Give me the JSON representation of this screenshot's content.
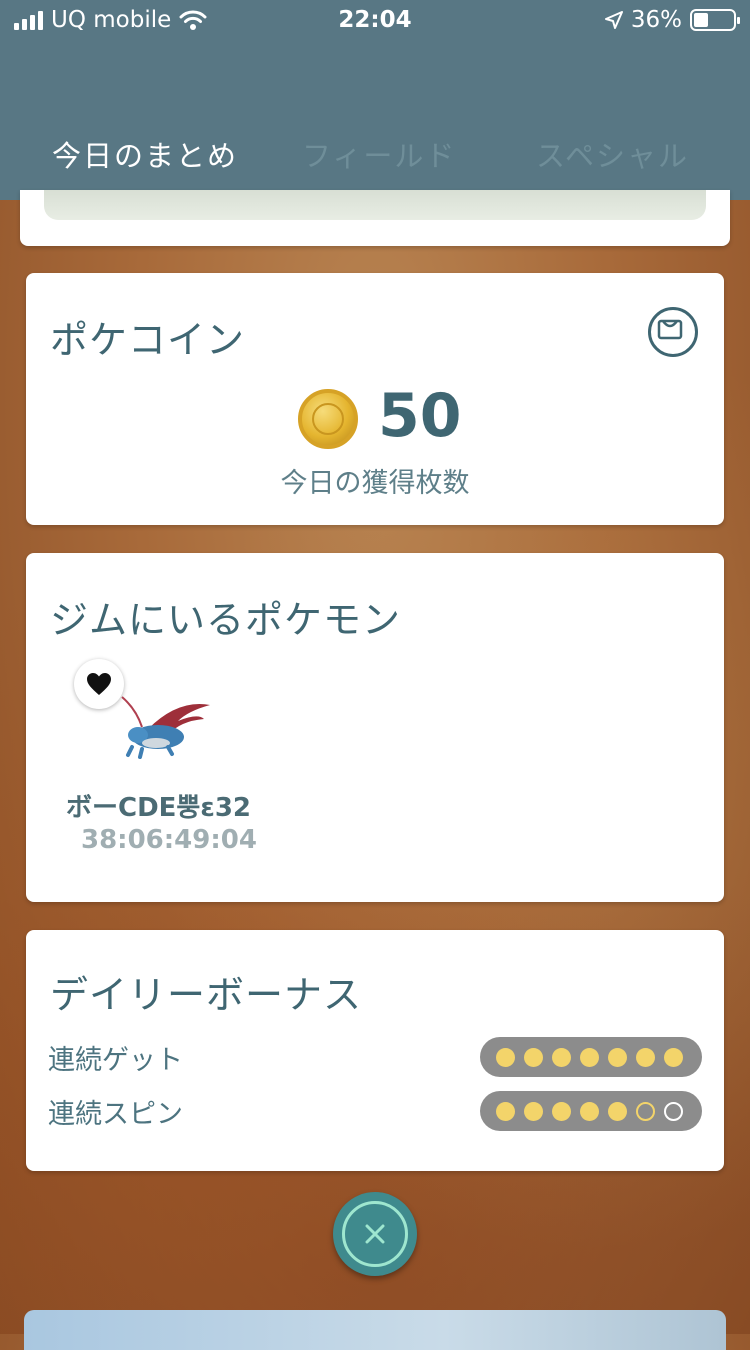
{
  "status_bar": {
    "carrier": "UQ mobile",
    "time": "22:04",
    "battery_percent": "36%",
    "battery_level": 0.36
  },
  "tabs": [
    {
      "label": "今日のまとめ",
      "active": true
    },
    {
      "label": "フィールド",
      "active": false
    },
    {
      "label": "スペシャル",
      "active": false
    }
  ],
  "pokecoin": {
    "title": "ポケコイン",
    "amount": "50",
    "caption": "今日の獲得枚数"
  },
  "gym": {
    "title": "ジムにいるポケモン",
    "gym_name": "ボーCDE뿡ɛ32",
    "timer": "38:06:49:04"
  },
  "daily_bonus": {
    "title": "デイリーボーナス",
    "rows": [
      {
        "label": "連続ゲット",
        "filled": 7,
        "total": 7
      },
      {
        "label": "連続スピン",
        "filled": 5,
        "total": 7
      }
    ]
  },
  "colors": {
    "header": "#587784",
    "title_text": "#3f6672",
    "dot_yellow": "#f3d46a",
    "close_button": "#3f8a8d"
  },
  "icons": [
    "wifi-icon",
    "location-arrow-icon",
    "shop-bag-icon",
    "coin-icon",
    "heart-icon",
    "close-icon"
  ]
}
